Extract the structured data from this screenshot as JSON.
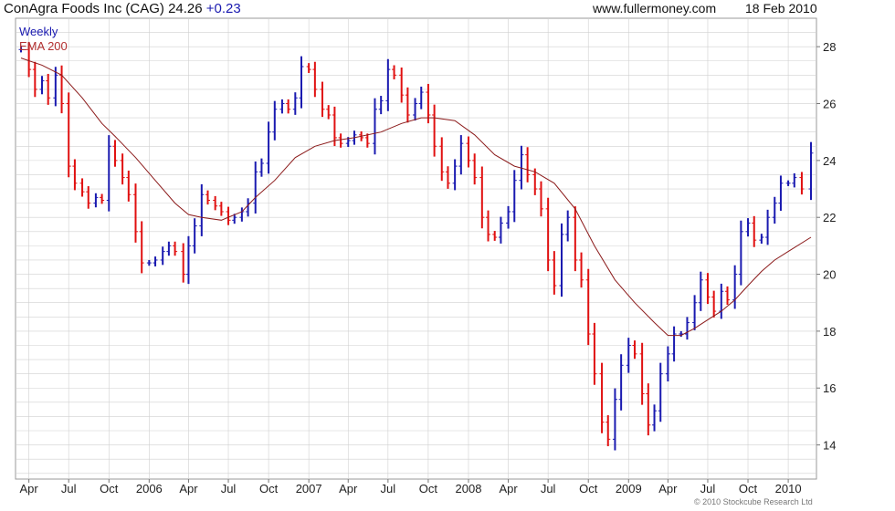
{
  "header": {
    "title": "ConAgra Foods Inc (CAG) 24.26",
    "change": "+0.23",
    "site": "www.fullermoney.com",
    "date": "18 Feb 2010"
  },
  "legend": {
    "series1": "Weekly",
    "series2": "EMA 200"
  },
  "copyright": "© 2010 Stockcube Research Ltd",
  "colors": {
    "up": "#1a1ab0",
    "down": "#e01010",
    "ema": "#8b1a1a",
    "grid": "#d0d0d0"
  },
  "chart_data": {
    "type": "line",
    "title": "ConAgra Foods Inc (CAG)",
    "ylim": [
      12.8,
      29.0
    ],
    "y_ticks": [
      14,
      16,
      18,
      20,
      22,
      24,
      26,
      28
    ],
    "x_domain": [
      "2005-03-14",
      "2010-02-22"
    ],
    "x_ticks": [
      {
        "date": "2005-04-01",
        "label": "Apr"
      },
      {
        "date": "2005-07-01",
        "label": "Jul"
      },
      {
        "date": "2005-10-01",
        "label": "Oct"
      },
      {
        "date": "2006-01-01",
        "label": "2006"
      },
      {
        "date": "2006-04-01",
        "label": "Apr"
      },
      {
        "date": "2006-07-01",
        "label": "Jul"
      },
      {
        "date": "2006-10-01",
        "label": "Oct"
      },
      {
        "date": "2007-01-01",
        "label": "2007"
      },
      {
        "date": "2007-04-01",
        "label": "Apr"
      },
      {
        "date": "2007-07-01",
        "label": "Jul"
      },
      {
        "date": "2007-10-01",
        "label": "Oct"
      },
      {
        "date": "2008-01-01",
        "label": "2008"
      },
      {
        "date": "2008-04-01",
        "label": "Apr"
      },
      {
        "date": "2008-07-01",
        "label": "Jul"
      },
      {
        "date": "2008-10-01",
        "label": "Oct"
      },
      {
        "date": "2009-01-01",
        "label": "2009"
      },
      {
        "date": "2009-04-01",
        "label": "Apr"
      },
      {
        "date": "2009-07-01",
        "label": "Jul"
      },
      {
        "date": "2009-10-01",
        "label": "Oct"
      },
      {
        "date": "2010-01-01",
        "label": "2010"
      }
    ],
    "grid": true,
    "legend_position": "top-left",
    "series": [
      {
        "name": "Weekly",
        "style": "weekly price bars",
        "points": [
          [
            "2005-03-14",
            27.9
          ],
          [
            "2005-04-01",
            27.2
          ],
          [
            "2005-04-15",
            26.5
          ],
          [
            "2005-05-01",
            26.8
          ],
          [
            "2005-05-15",
            26.2
          ],
          [
            "2005-06-01",
            27.0
          ],
          [
            "2005-06-15",
            26.0
          ],
          [
            "2005-07-01",
            23.8
          ],
          [
            "2005-07-15",
            23.2
          ],
          [
            "2005-08-01",
            22.9
          ],
          [
            "2005-08-15",
            22.5
          ],
          [
            "2005-09-01",
            22.7
          ],
          [
            "2005-09-15",
            22.6
          ],
          [
            "2005-10-01",
            24.5
          ],
          [
            "2005-10-15",
            24.0
          ],
          [
            "2005-11-01",
            23.4
          ],
          [
            "2005-11-15",
            22.8
          ],
          [
            "2005-12-01",
            21.5
          ],
          [
            "2005-12-15",
            20.4
          ],
          [
            "2006-01-01",
            20.4
          ],
          [
            "2006-01-15",
            20.5
          ],
          [
            "2006-02-01",
            20.8
          ],
          [
            "2006-02-15",
            21.0
          ],
          [
            "2006-03-01",
            20.8
          ],
          [
            "2006-03-20",
            20.0
          ],
          [
            "2006-04-01",
            21.0
          ],
          [
            "2006-04-15",
            21.7
          ],
          [
            "2006-05-01",
            22.8
          ],
          [
            "2006-05-15",
            22.6
          ],
          [
            "2006-06-01",
            22.4
          ],
          [
            "2006-06-15",
            22.2
          ],
          [
            "2006-07-01",
            21.9
          ],
          [
            "2006-07-15",
            22.0
          ],
          [
            "2006-08-01",
            22.2
          ],
          [
            "2006-08-15",
            22.5
          ],
          [
            "2006-09-01",
            23.6
          ],
          [
            "2006-09-15",
            23.9
          ],
          [
            "2006-10-01",
            25.0
          ],
          [
            "2006-10-15",
            25.8
          ],
          [
            "2006-11-01",
            26.0
          ],
          [
            "2006-11-15",
            25.8
          ],
          [
            "2006-12-01",
            26.2
          ],
          [
            "2006-12-15",
            27.3
          ],
          [
            "2007-01-01",
            27.2
          ],
          [
            "2007-01-15",
            26.5
          ],
          [
            "2007-02-01",
            25.8
          ],
          [
            "2007-02-15",
            25.6
          ],
          [
            "2007-03-01",
            24.8
          ],
          [
            "2007-03-15",
            24.6
          ],
          [
            "2007-04-01",
            24.7
          ],
          [
            "2007-04-15",
            24.9
          ],
          [
            "2007-05-01",
            24.8
          ],
          [
            "2007-05-15",
            24.6
          ],
          [
            "2007-06-01",
            25.8
          ],
          [
            "2007-06-15",
            26.1
          ],
          [
            "2007-07-01",
            27.2
          ],
          [
            "2007-07-15",
            27.0
          ],
          [
            "2007-08-01",
            26.3
          ],
          [
            "2007-08-15",
            25.6
          ],
          [
            "2007-09-01",
            26.0
          ],
          [
            "2007-09-15",
            26.4
          ],
          [
            "2007-10-01",
            25.6
          ],
          [
            "2007-10-15",
            24.5
          ],
          [
            "2007-11-01",
            23.6
          ],
          [
            "2007-11-15",
            23.2
          ],
          [
            "2007-12-01",
            23.8
          ],
          [
            "2007-12-15",
            24.6
          ],
          [
            "2008-01-01",
            24.0
          ],
          [
            "2008-01-15",
            23.4
          ],
          [
            "2008-02-01",
            22.0
          ],
          [
            "2008-02-15",
            21.4
          ],
          [
            "2008-03-01",
            21.3
          ],
          [
            "2008-03-15",
            21.8
          ],
          [
            "2008-04-01",
            22.2
          ],
          [
            "2008-04-15",
            23.3
          ],
          [
            "2008-05-01",
            24.2
          ],
          [
            "2008-05-15",
            23.5
          ],
          [
            "2008-06-01",
            23.0
          ],
          [
            "2008-06-15",
            22.3
          ],
          [
            "2008-07-01",
            20.5
          ],
          [
            "2008-07-15",
            19.6
          ],
          [
            "2008-08-01",
            21.4
          ],
          [
            "2008-08-15",
            22.0
          ],
          [
            "2008-09-01",
            20.5
          ],
          [
            "2008-09-15",
            19.8
          ],
          [
            "2008-10-01",
            17.9
          ],
          [
            "2008-10-15",
            16.5
          ],
          [
            "2008-11-01",
            14.8
          ],
          [
            "2008-11-15",
            14.2
          ],
          [
            "2008-12-01",
            15.6
          ],
          [
            "2008-12-15",
            16.8
          ],
          [
            "2009-01-01",
            17.5
          ],
          [
            "2009-01-15",
            17.2
          ],
          [
            "2009-02-01",
            15.8
          ],
          [
            "2009-02-15",
            14.7
          ],
          [
            "2009-03-01",
            15.2
          ],
          [
            "2009-03-15",
            16.5
          ],
          [
            "2009-04-01",
            17.2
          ],
          [
            "2009-04-15",
            17.9
          ],
          [
            "2009-05-01",
            17.9
          ],
          [
            "2009-05-15",
            18.3
          ],
          [
            "2009-06-01",
            19.0
          ],
          [
            "2009-06-15",
            19.8
          ],
          [
            "2009-07-01",
            19.2
          ],
          [
            "2009-07-15",
            18.7
          ],
          [
            "2009-08-01",
            19.4
          ],
          [
            "2009-08-15",
            19.1
          ],
          [
            "2009-09-01",
            20.0
          ],
          [
            "2009-09-15",
            21.5
          ],
          [
            "2009-10-01",
            21.8
          ],
          [
            "2009-10-15",
            21.2
          ],
          [
            "2009-11-01",
            21.3
          ],
          [
            "2009-11-15",
            22.0
          ],
          [
            "2009-12-01",
            22.5
          ],
          [
            "2009-12-15",
            23.2
          ],
          [
            "2010-01-01",
            23.2
          ],
          [
            "2010-01-15",
            23.4
          ],
          [
            "2010-02-01",
            23.0
          ],
          [
            "2010-02-22",
            24.26
          ]
        ]
      },
      {
        "name": "EMA 200",
        "points": [
          [
            "2005-03-14",
            27.6
          ],
          [
            "2005-05-01",
            27.35
          ],
          [
            "2005-06-15",
            27.0
          ],
          [
            "2005-08-01",
            26.2
          ],
          [
            "2005-09-15",
            25.3
          ],
          [
            "2005-10-15",
            24.85
          ],
          [
            "2005-12-01",
            24.1
          ],
          [
            "2006-01-15",
            23.3
          ],
          [
            "2006-03-01",
            22.5
          ],
          [
            "2006-04-01",
            22.1
          ],
          [
            "2006-05-01",
            22.0
          ],
          [
            "2006-06-15",
            21.9
          ],
          [
            "2006-08-01",
            22.2
          ],
          [
            "2006-09-01",
            22.7
          ],
          [
            "2006-10-15",
            23.3
          ],
          [
            "2006-12-01",
            24.1
          ],
          [
            "2007-01-15",
            24.5
          ],
          [
            "2007-03-01",
            24.7
          ],
          [
            "2007-04-15",
            24.8
          ],
          [
            "2007-06-15",
            25.0
          ],
          [
            "2007-08-01",
            25.3
          ],
          [
            "2007-09-15",
            25.5
          ],
          [
            "2007-10-15",
            25.5
          ],
          [
            "2007-12-01",
            25.4
          ],
          [
            "2008-01-15",
            24.9
          ],
          [
            "2008-03-01",
            24.2
          ],
          [
            "2008-04-15",
            23.8
          ],
          [
            "2008-06-01",
            23.6
          ],
          [
            "2008-07-15",
            23.2
          ],
          [
            "2008-09-01",
            22.3
          ],
          [
            "2008-10-15",
            21.0
          ],
          [
            "2008-12-01",
            19.8
          ],
          [
            "2009-01-15",
            19.0
          ],
          [
            "2009-03-01",
            18.3
          ],
          [
            "2009-04-01",
            17.85
          ],
          [
            "2009-05-01",
            17.85
          ],
          [
            "2009-06-01",
            18.1
          ],
          [
            "2009-07-01",
            18.4
          ],
          [
            "2009-08-01",
            18.7
          ],
          [
            "2009-09-01",
            19.1
          ],
          [
            "2009-10-01",
            19.6
          ],
          [
            "2009-11-01",
            20.1
          ],
          [
            "2009-12-01",
            20.5
          ],
          [
            "2010-01-01",
            20.8
          ],
          [
            "2010-02-22",
            21.3
          ]
        ]
      }
    ]
  }
}
